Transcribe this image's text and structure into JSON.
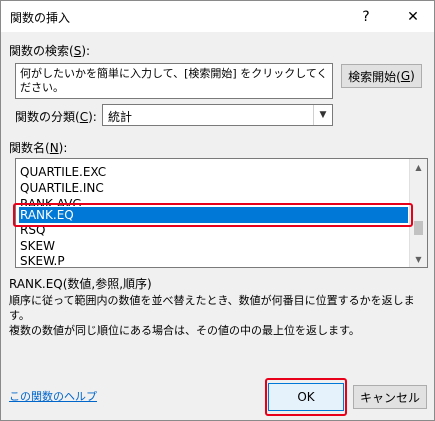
{
  "window": {
    "title": "関数の挿入",
    "help_glyph": "?",
    "close_glyph": "✕"
  },
  "search": {
    "label": "関数の検索(",
    "label_key": "S",
    "label_end": "):",
    "description": "何がしたいかを簡単に入力して、[検索開始] をクリックしてください。",
    "button_label": "検索開始(",
    "button_key": "G",
    "button_end": ")"
  },
  "category": {
    "label": "関数の分類(",
    "label_key": "C",
    "label_end": "):",
    "selected": "統計"
  },
  "functions": {
    "label": "関数名(",
    "label_key": "N",
    "label_end": "):",
    "items": [
      "QUARTILE.EXC",
      "QUARTILE.INC",
      "RANK.AVG",
      "RANK.EQ",
      "RSQ",
      "SKEW",
      "SKEW.P"
    ],
    "selected_index": 3
  },
  "detail": {
    "syntax": "RANK.EQ(数値,参照,順序)",
    "line1": "順序に従って範囲内の数値を並べ替えたとき、数値が何番目に位置するかを返します。",
    "line2": "複数の数値が同じ順位にある場合は、その値の中の最上位を返します。"
  },
  "footer": {
    "help_link": "この関数のヘルプ",
    "ok_label": "OK",
    "cancel_label": "キャンセル"
  },
  "colors": {
    "selection": "#0078d7",
    "highlight": "#e8001b",
    "link": "#0066cc"
  }
}
